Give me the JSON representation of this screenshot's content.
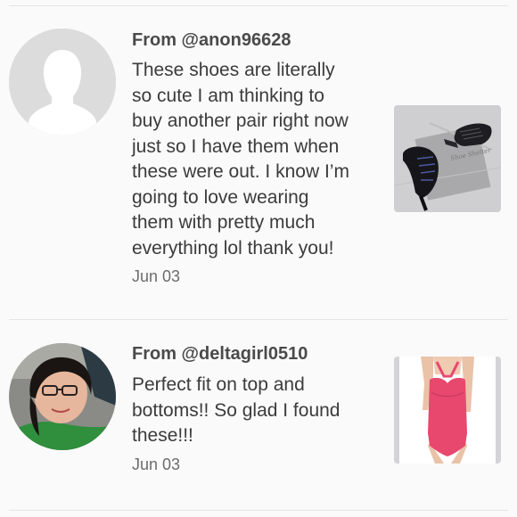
{
  "reviews": [
    {
      "from": "From @anon96628",
      "text": "These shoes are literally so cute I am thinking to buy another pair right now just so I have them when these were out. I know I’m going to love wearing them with pretty much everything lol thank you!",
      "lines": [
        "These shoes are literally",
        "so cute I am thinking to",
        "buy another pair right now",
        "just so I have them when",
        "these were out. I know I’m",
        "going to love wearing",
        "them with pretty much",
        "everything lol thank you!"
      ],
      "date": "Jun 03",
      "avatar_icon": "default-person-icon",
      "thumbnail": "black-lace-up-heeled-booties",
      "thumbnail_watermark": "Shoe Shelter"
    },
    {
      "from": "From @deltagirl0510",
      "text": "Perfect fit on top and bottoms!! So glad I found these!!!",
      "lines": [
        "Perfect fit on top and",
        "bottoms!! So glad I found",
        "these!!!"
      ],
      "date": "Jun 03",
      "avatar_icon": "user-photo",
      "thumbnail": "pink-halter-swimsuit"
    }
  ],
  "colors": {
    "background": "#fbfafb",
    "divider": "#e6e3e6",
    "text": "#3b3b3b",
    "muted": "#6c6c6c",
    "swimsuit": "#e8476e"
  }
}
